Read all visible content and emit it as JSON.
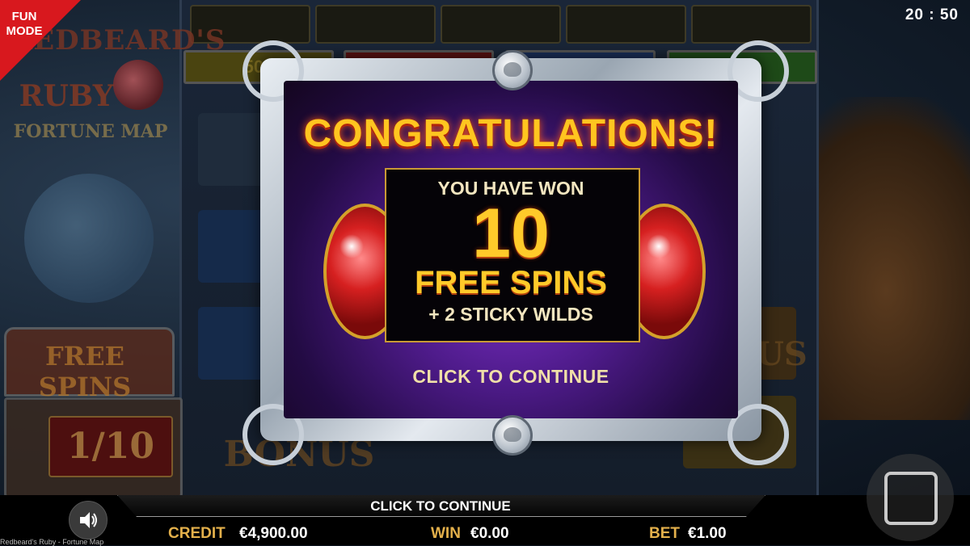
{
  "badge": {
    "text": "FUN\nMODE",
    "color": "#d8181e"
  },
  "clock": "20 : 50",
  "background": {
    "brand_line1": "REDBEARD'S",
    "brand_line2": "RUBY",
    "brand_sub": "FORTUNE MAP",
    "chest_label": "FREE SPINS",
    "chest_counter": "1/10",
    "bonus_left": "BONUS BONUS",
    "bonus_right": "US",
    "reel_bar_text": "500"
  },
  "modal": {
    "title": "CONGRATULATIONS!",
    "line1": "YOU HAVE WON",
    "spins_count": "10",
    "line3": "FREE SPINS",
    "line4": "+ 2 STICKY WILDS",
    "cta": "CLICK TO CONTINUE"
  },
  "bottom_bar": {
    "cta": "CLICK TO CONTINUE",
    "credit_label": "CREDIT",
    "credit_value": "€4,900.00",
    "win_label": "WIN",
    "win_value": "€0.00",
    "bet_label": "BET",
    "bet_value": "€1.00",
    "game_name": "Redbeard's Ruby - Fortune Map"
  },
  "colors": {
    "accent_gold": "#ffc520",
    "label_gold": "#e3b04b",
    "modal_purple": "#4e1b8a"
  },
  "icons": {
    "sound": "speaker-icon",
    "stop": "stop-square-icon",
    "knob": "skull-emblem-icon"
  }
}
